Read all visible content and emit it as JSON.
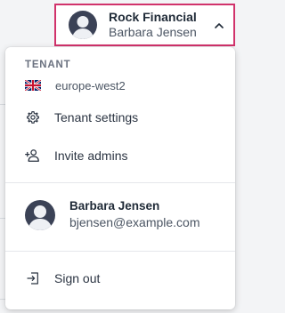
{
  "account": {
    "company": "Rock Financial",
    "user_name": "Barbara Jensen"
  },
  "menu": {
    "section_label": "TENANT",
    "region": "europe-west2",
    "items": [
      {
        "label": "Tenant settings",
        "icon": "gear-icon"
      },
      {
        "label": "Invite admins",
        "icon": "person-add-icon"
      }
    ],
    "user": {
      "name": "Barbara Jensen",
      "email": "bjensen@example.com"
    },
    "sign_out": "Sign out"
  },
  "colors": {
    "focus_border": "#d1326b",
    "avatar": "#3b4256"
  }
}
